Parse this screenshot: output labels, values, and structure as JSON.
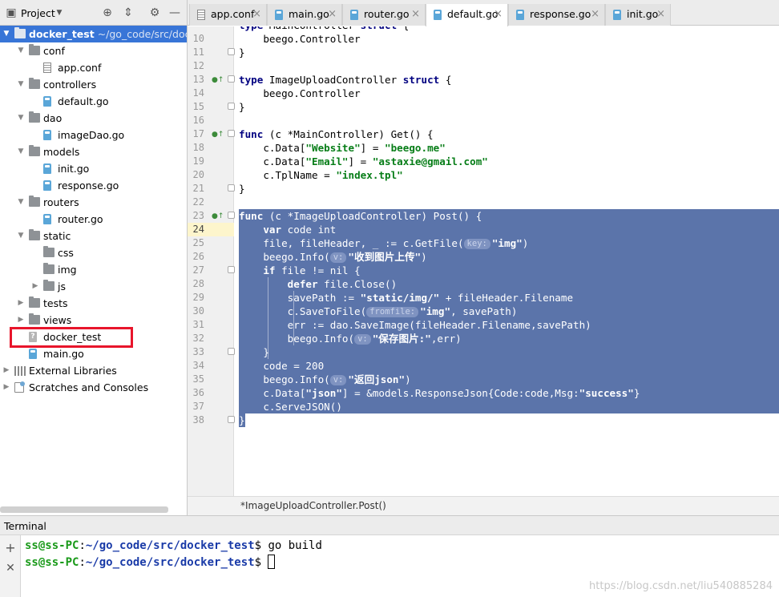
{
  "project_panel": {
    "title": "Project",
    "tree": [
      {
        "label": "docker_test",
        "path": "~/go_code/src/docker_",
        "type": "folder",
        "depth": 0,
        "expanded": true,
        "selected": true
      },
      {
        "label": "conf",
        "type": "folder",
        "depth": 1,
        "expanded": true
      },
      {
        "label": "app.conf",
        "type": "conf",
        "depth": 2
      },
      {
        "label": "controllers",
        "type": "folder",
        "depth": 1,
        "expanded": true
      },
      {
        "label": "default.go",
        "type": "go",
        "depth": 2
      },
      {
        "label": "dao",
        "type": "folder",
        "depth": 1,
        "expanded": true
      },
      {
        "label": "imageDao.go",
        "type": "go",
        "depth": 2
      },
      {
        "label": "models",
        "type": "folder",
        "depth": 1,
        "expanded": true
      },
      {
        "label": "init.go",
        "type": "go",
        "depth": 2
      },
      {
        "label": "response.go",
        "type": "go",
        "depth": 2
      },
      {
        "label": "routers",
        "type": "folder",
        "depth": 1,
        "expanded": true
      },
      {
        "label": "router.go",
        "type": "go",
        "depth": 2
      },
      {
        "label": "static",
        "type": "folder",
        "depth": 1,
        "expanded": true
      },
      {
        "label": "css",
        "type": "folder",
        "depth": 2,
        "leaf": true
      },
      {
        "label": "img",
        "type": "folder",
        "depth": 2,
        "leaf": true
      },
      {
        "label": "js",
        "type": "folder",
        "depth": 2,
        "expanded": false
      },
      {
        "label": "tests",
        "type": "folder",
        "depth": 1,
        "expanded": false
      },
      {
        "label": "views",
        "type": "folder",
        "depth": 1,
        "expanded": false
      },
      {
        "label": "docker_test",
        "type": "binary",
        "depth": 1,
        "highlighted": true
      },
      {
        "label": "main.go",
        "type": "go",
        "depth": 1
      },
      {
        "label": "External Libraries",
        "type": "library",
        "depth": 0,
        "expanded": false
      },
      {
        "label": "Scratches and Consoles",
        "type": "scratch",
        "depth": 0,
        "expanded": false
      }
    ]
  },
  "tabs": [
    {
      "label": "app.conf",
      "icon": "config-file-icon"
    },
    {
      "label": "main.go",
      "icon": "go-file-icon"
    },
    {
      "label": "router.go",
      "icon": "go-file-icon"
    },
    {
      "label": "default.go",
      "icon": "go-file-icon",
      "active": true
    },
    {
      "label": "response.go",
      "icon": "go-file-icon"
    },
    {
      "label": "init.go",
      "icon": "go-file-icon"
    }
  ],
  "editor": {
    "current_line": 24,
    "selected_lines": [
      23,
      38
    ],
    "lines": [
      {
        "n": 10,
        "tokens": [
          [
            "",
            "    beego.Controller"
          ]
        ]
      },
      {
        "n": 11,
        "tokens": [
          [
            "",
            "}"
          ]
        ]
      },
      {
        "n": 12,
        "tokens": [
          [
            "",
            ""
          ]
        ]
      },
      {
        "n": 13,
        "tokens": [
          [
            "kw",
            "type"
          ],
          [
            "",
            " ImageUploadController "
          ],
          [
            "kw",
            "struct"
          ],
          [
            "",
            " {"
          ]
        ],
        "impl": true
      },
      {
        "n": 14,
        "tokens": [
          [
            "",
            "    beego.Controller"
          ]
        ]
      },
      {
        "n": 15,
        "tokens": [
          [
            "",
            "}"
          ]
        ]
      },
      {
        "n": 16,
        "tokens": [
          [
            "",
            ""
          ]
        ]
      },
      {
        "n": 17,
        "tokens": [
          [
            "kw",
            "func"
          ],
          [
            "",
            " (c *MainController) Get() {"
          ]
        ],
        "impl": true
      },
      {
        "n": 18,
        "tokens": [
          [
            "",
            "    c.Data["
          ],
          [
            "str",
            "\"Website\""
          ],
          [
            "",
            "] = "
          ],
          [
            "str",
            "\"beego.me\""
          ]
        ]
      },
      {
        "n": 19,
        "tokens": [
          [
            "",
            "    c.Data["
          ],
          [
            "str",
            "\"Email\""
          ],
          [
            "",
            "] = "
          ],
          [
            "str",
            "\"astaxie@gmail.com\""
          ]
        ]
      },
      {
        "n": 20,
        "tokens": [
          [
            "",
            "    c.TplName = "
          ],
          [
            "str",
            "\"index.tpl\""
          ]
        ]
      },
      {
        "n": 21,
        "tokens": [
          [
            "",
            "}"
          ]
        ]
      },
      {
        "n": 22,
        "tokens": [
          [
            "",
            ""
          ]
        ]
      },
      {
        "n": 23,
        "tokens": [
          [
            "kw",
            "func"
          ],
          [
            "",
            " (c *ImageUploadController) Post() {"
          ]
        ],
        "impl": true
      },
      {
        "n": 24,
        "tokens": [
          [
            "",
            "    "
          ],
          [
            "kw",
            "var"
          ],
          [
            "",
            " code int"
          ]
        ]
      },
      {
        "n": 25,
        "tokens": [
          [
            "",
            "    file, fileHeader, _ := c.GetFile("
          ],
          [
            "hint",
            "key:"
          ],
          [
            "str",
            "\"img\""
          ],
          [
            "",
            ")"
          ]
        ]
      },
      {
        "n": 26,
        "tokens": [
          [
            "",
            "    beego.Info("
          ],
          [
            "hint",
            "v:"
          ],
          [
            "str",
            "\"收到图片上传\""
          ],
          [
            "",
            ")"
          ]
        ]
      },
      {
        "n": 27,
        "tokens": [
          [
            "",
            "    "
          ],
          [
            "kw",
            "if"
          ],
          [
            "",
            " file != nil {"
          ]
        ]
      },
      {
        "n": 28,
        "tokens": [
          [
            "",
            "        "
          ],
          [
            "kw",
            "defer"
          ],
          [
            "",
            " file.Close()"
          ]
        ]
      },
      {
        "n": 29,
        "tokens": [
          [
            "",
            "        savePath := "
          ],
          [
            "str",
            "\"static/img/\""
          ],
          [
            "",
            " + fileHeader.Filename"
          ]
        ]
      },
      {
        "n": 30,
        "tokens": [
          [
            "",
            "        c.SaveToFile("
          ],
          [
            "hint",
            "fromfile:"
          ],
          [
            "str",
            "\"img\""
          ],
          [
            "",
            ", savePath)"
          ]
        ]
      },
      {
        "n": 31,
        "tokens": [
          [
            "",
            "        err := dao.SaveImage(fileHeader.Filename,savePath)"
          ]
        ]
      },
      {
        "n": 32,
        "tokens": [
          [
            "",
            "        beego.Info("
          ],
          [
            "hint",
            "v:"
          ],
          [
            "str",
            "\"保存图片:\""
          ],
          [
            "",
            ",err)"
          ]
        ]
      },
      {
        "n": 33,
        "tokens": [
          [
            "",
            "    }"
          ]
        ]
      },
      {
        "n": 34,
        "tokens": [
          [
            "",
            "    code = 200"
          ]
        ]
      },
      {
        "n": 35,
        "tokens": [
          [
            "",
            "    beego.Info("
          ],
          [
            "hint",
            "v:"
          ],
          [
            "str",
            "\"返回json\""
          ],
          [
            "",
            ")"
          ]
        ]
      },
      {
        "n": 36,
        "tokens": [
          [
            "",
            "    c.Data["
          ],
          [
            "str",
            "\"json\""
          ],
          [
            "",
            "] = &models.ResponseJson{Code:code,Msg:"
          ],
          [
            "str",
            "\"success\""
          ],
          [
            "",
            "}"
          ]
        ]
      },
      {
        "n": 37,
        "tokens": [
          [
            "",
            "    c.ServeJSON()"
          ]
        ]
      },
      {
        "n": 38,
        "tokens": [
          [
            "",
            "}"
          ]
        ]
      }
    ]
  },
  "breadcrumb": "*ImageUploadController.Post()",
  "terminal": {
    "title": "Terminal",
    "lines": [
      {
        "user": "ss@ss-PC",
        "path": "~/go_code/src/docker_test",
        "command": " go build"
      },
      {
        "user": "ss@ss-PC",
        "path": "~/go_code/src/docker_test",
        "command": " ",
        "cursor": true
      }
    ]
  },
  "watermark": "https://blog.csdn.net/liu540885284",
  "colors": {
    "selection": "#5b74aa",
    "keyword": "#000080",
    "string": "#067d17",
    "tree_selection": "#3875d7",
    "highlight_box": "#e8152b"
  }
}
